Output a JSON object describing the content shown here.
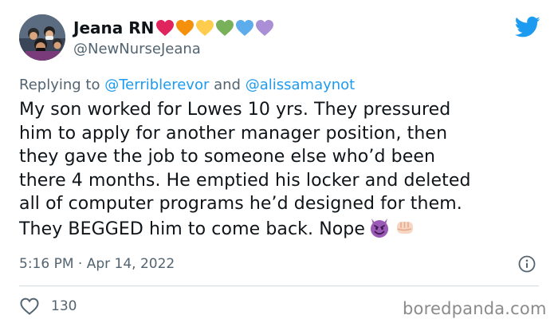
{
  "author": {
    "display_name": "Jeana RN",
    "handle": "@NewNurseJeana",
    "avatar_icon": "group-photo-avatar",
    "heart_colors": [
      "#e0245e",
      "#f4900c",
      "#ffcc4d",
      "#78b159",
      "#5dadec",
      "#aa8ed6"
    ]
  },
  "platform_icon": "twitter-bird-icon",
  "brand_color": "#1d9bf0",
  "reply": {
    "prefix": "Replying to",
    "mention_1": "@Terriblerevor",
    "conjunction": "and",
    "mention_2": "@alissamaynot"
  },
  "tweet": {
    "lines": [
      "My son worked for Lowes 10 yrs. They pressured",
      "him to apply for another manager position, then",
      "they gave the job to someone else who’d been",
      "there 4 months. He emptied his locker and deleted",
      "all of computer programs he’d designed for them.",
      "They BEGGED him to come back. Nope"
    ],
    "emojis": [
      "smiling-devil-emoji",
      "fist-emoji"
    ]
  },
  "meta": {
    "timestamp": "5:16 PM · Apr 14, 2022",
    "info_icon": "info-icon"
  },
  "actions": {
    "like_icon": "heart-outline-icon",
    "like_count": "130"
  },
  "watermark": "boredpanda.com"
}
